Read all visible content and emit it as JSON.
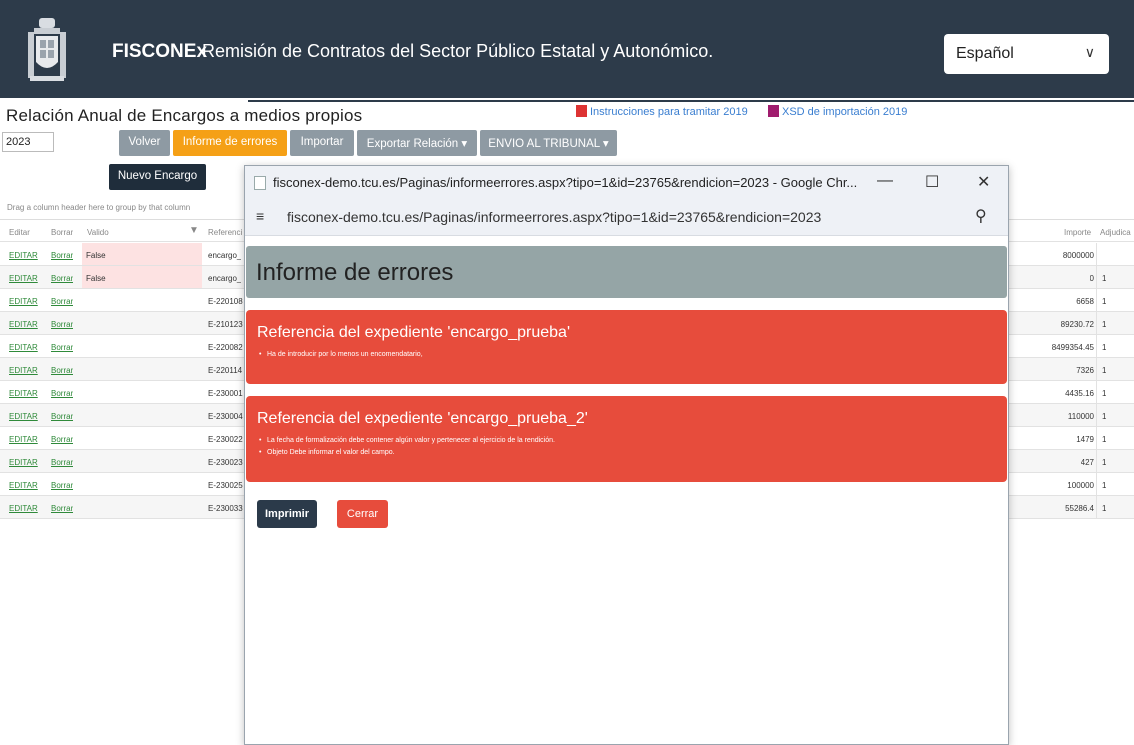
{
  "header": {
    "brand": "FISCONEx",
    "subtitle": "Remisión de Contratos del Sector Público Estatal y Autonómico.",
    "language": "Español"
  },
  "page": {
    "title": "Relación Anual de Encargos a medios propios",
    "link_instructions": "Instrucciones para tramitar 2019",
    "link_xsd": "XSD de importación 2019",
    "year": "2023",
    "group_hint": "Drag a column header here to group by that column"
  },
  "toolbar": {
    "volver": "Volver",
    "informe": "Informe de errores",
    "importar": "Importar",
    "exportar": "Exportar Relación",
    "envio": "ENVIO AL TRIBUNAL",
    "nuevo": "Nuevo Encargo"
  },
  "grid": {
    "headers": {
      "editar": "Editar",
      "borrar": "Borrar",
      "valido": "Valido",
      "referencia": "Referenci",
      "importe": "Importe",
      "adjudica": "Adjudica"
    },
    "rows": [
      {
        "editar": "EDITAR",
        "borrar": "Borrar",
        "valido": "False",
        "ref": "encargo_",
        "importe": "8000000",
        "adj": ""
      },
      {
        "editar": "EDITAR",
        "borrar": "Borrar",
        "valido": "False",
        "ref": "encargo_",
        "importe": "0",
        "adj": "1"
      },
      {
        "editar": "EDITAR",
        "borrar": "Borrar",
        "valido": "",
        "ref": "E-220108",
        "importe": "6658",
        "adj": "1"
      },
      {
        "editar": "EDITAR",
        "borrar": "Borrar",
        "valido": "",
        "ref": "E-210123",
        "importe": "89230.72",
        "adj": "1"
      },
      {
        "editar": "EDITAR",
        "borrar": "Borrar",
        "valido": "",
        "ref": "E-220082",
        "importe": "8499354.45",
        "adj": "1"
      },
      {
        "editar": "EDITAR",
        "borrar": "Borrar",
        "valido": "",
        "ref": "E-220114",
        "importe": "7326",
        "adj": "1"
      },
      {
        "editar": "EDITAR",
        "borrar": "Borrar",
        "valido": "",
        "ref": "E-230001",
        "importe": "4435.16",
        "adj": "1"
      },
      {
        "editar": "EDITAR",
        "borrar": "Borrar",
        "valido": "",
        "ref": "E-230004",
        "importe": "110000",
        "adj": "1"
      },
      {
        "editar": "EDITAR",
        "borrar": "Borrar",
        "valido": "",
        "ref": "E-230022",
        "importe": "1479",
        "adj": "1"
      },
      {
        "editar": "EDITAR",
        "borrar": "Borrar",
        "valido": "",
        "ref": "E-230023",
        "importe": "427",
        "adj": "1"
      },
      {
        "editar": "EDITAR",
        "borrar": "Borrar",
        "valido": "",
        "ref": "E-230025",
        "importe": "100000",
        "adj": "1"
      },
      {
        "editar": "EDITAR",
        "borrar": "Borrar",
        "valido": "",
        "ref": "E-230033",
        "importe": "55286.4",
        "adj": "1"
      }
    ]
  },
  "popup": {
    "window_title": "fisconex-demo.tcu.es/Paginas/informeerrores.aspx?tipo=1&id=23765&rendicion=2023 - Google Chr...",
    "url": "fisconex-demo.tcu.es/Paginas/informeerrores.aspx?tipo=1&id=23765&rendicion=2023",
    "report_title": "Informe de errores",
    "errors": [
      {
        "title": "Referencia del expediente 'encargo_prueba'",
        "items": [
          "Ha de introducir por lo menos un encomendatario,"
        ]
      },
      {
        "title": "Referencia del expediente 'encargo_prueba_2'",
        "items": [
          "La fecha de formalización debe contener algún valor y pertenecer al ejercicio de la rendición.",
          "Objeto Debe informar el valor del campo."
        ]
      }
    ],
    "print_label": "Imprimir",
    "close_label": "Cerrar"
  }
}
